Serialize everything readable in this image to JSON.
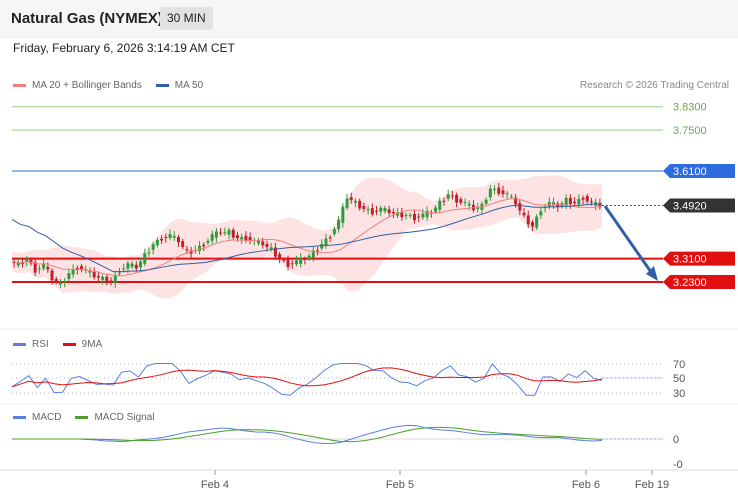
{
  "header": {
    "title": "Natural Gas (NYMEX)",
    "interval": "30 MIN",
    "datetime": "Friday, February 6, 2026 3:14:19 AM CET"
  },
  "legend": {
    "ma20": "MA 20 + Bollinger Bands",
    "ma50": "MA 50",
    "copyright": "Research © 2026 Trading Central"
  },
  "colors": {
    "ma20": "#f08080",
    "ma50": "#2e5fa8",
    "band": "#fde3e3",
    "bull": "#2e9c3a",
    "bear": "#c0202a",
    "support": "#e01010",
    "resistance_blue": "#2d6cdf",
    "target_green": "#6aa84f",
    "last_price": "#333333",
    "rsi": "#5b7fe0",
    "rsi_ma": "#e01010",
    "macd": "#5b7fe0",
    "macd_signal": "#4aa02a"
  },
  "price_levels": [
    {
      "value": 3.83,
      "label": "3.8300",
      "style": "green-line"
    },
    {
      "value": 3.75,
      "label": "3.7500",
      "style": "green-line"
    },
    {
      "value": 3.61,
      "label": "3.6100",
      "style": "blue-tag"
    },
    {
      "value": 3.492,
      "label": "3.4920",
      "style": "last-price-tag"
    },
    {
      "value": 3.31,
      "label": "3.3100",
      "style": "red-tag"
    },
    {
      "value": 3.23,
      "label": "3.2300",
      "style": "red-tag"
    }
  ],
  "rsi_panel": {
    "legend_rsi": "RSI",
    "legend_ma": "9MA",
    "levels": [
      "70",
      "50",
      "30"
    ]
  },
  "macd_panel": {
    "legend_macd": "MACD",
    "legend_signal": "MACD Signal",
    "levels": [
      "0",
      "-0"
    ]
  },
  "x_axis": [
    "Feb 4",
    "Feb 5",
    "Feb 6",
    "Feb 19"
  ],
  "chart_data": {
    "type": "line",
    "instrument": "Natural Gas (NYMEX)",
    "interval": "30 MIN",
    "series": [
      {
        "name": "MA 20 + Bollinger Bands"
      },
      {
        "name": "MA 50"
      }
    ],
    "price_path": [
      3.3,
      3.29,
      3.31,
      3.27,
      3.29,
      3.24,
      3.22,
      3.26,
      3.28,
      3.27,
      3.25,
      3.24,
      3.23,
      3.27,
      3.29,
      3.28,
      3.32,
      3.36,
      3.38,
      3.39,
      3.37,
      3.33,
      3.34,
      3.36,
      3.39,
      3.4,
      3.4,
      3.38,
      3.38,
      3.37,
      3.36,
      3.34,
      3.31,
      3.29,
      3.3,
      3.31,
      3.33,
      3.36,
      3.39,
      3.44,
      3.52,
      3.5,
      3.48,
      3.47,
      3.48,
      3.47,
      3.46,
      3.46,
      3.45,
      3.46,
      3.47,
      3.5,
      3.53,
      3.51,
      3.5,
      3.48,
      3.49,
      3.55,
      3.54,
      3.53,
      3.5,
      3.45,
      3.42,
      3.48,
      3.5,
      3.49,
      3.51,
      3.5,
      3.52,
      3.5,
      3.49
    ],
    "last_price": 3.492,
    "forecast_arrow": {
      "from": 3.49,
      "to": 3.23
    },
    "yrange": [
      3.12,
      3.88
    ]
  }
}
